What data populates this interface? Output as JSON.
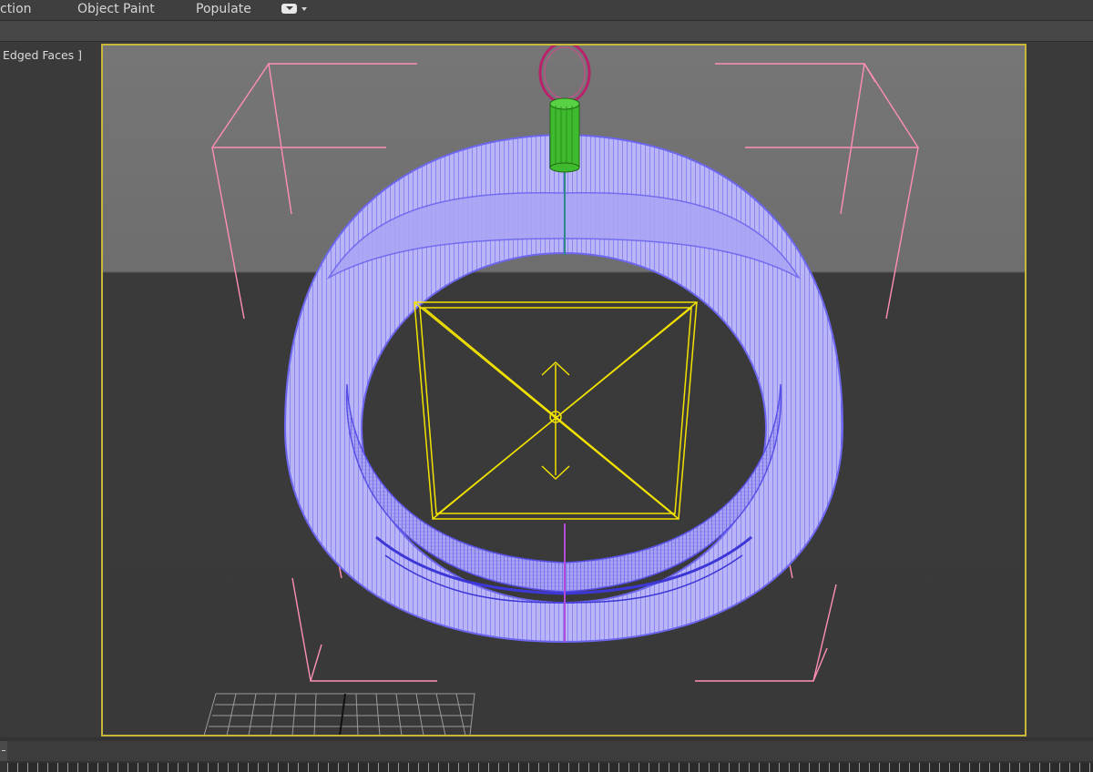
{
  "ribbon": {
    "tabs": [
      "ction",
      "Object Paint",
      "Populate"
    ],
    "toggle_icon": "ribbon-display-toggle-icon"
  },
  "viewport": {
    "label": "Edged Faces ]",
    "colors": {
      "border_active": "#c9b73a",
      "background_top": "#767676",
      "background_bottom": "#3a3a3a",
      "mesh_wireframe": "#6d66f0",
      "mesh_fill": "#b8b4f7",
      "camera_frame": "#ff8fb4",
      "light_gizmo": "#f2e200",
      "cylinder_object": "#3fba2e",
      "hook_ring": "#b8226d",
      "grid": "#9a9a9a"
    }
  }
}
